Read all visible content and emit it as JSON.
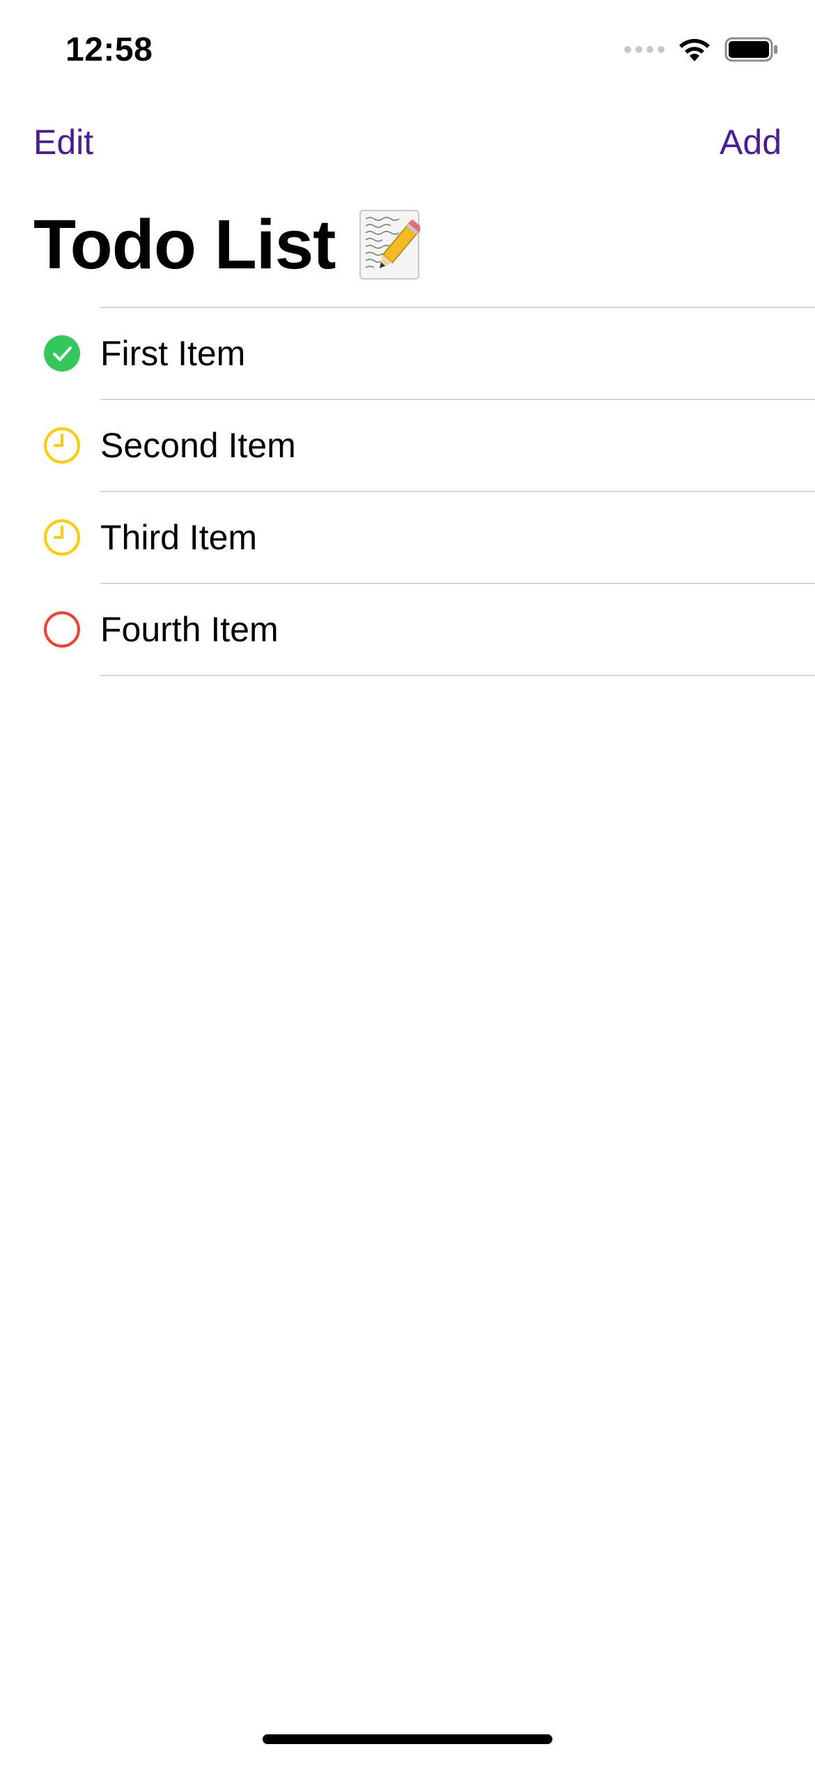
{
  "status_bar": {
    "time": "12:58",
    "icons": [
      "cellular-signal-icon",
      "wifi-icon",
      "battery-icon"
    ]
  },
  "nav": {
    "edit_label": "Edit",
    "add_label": "Add",
    "accent_color": "#4b1a99"
  },
  "title": {
    "text": "Todo List",
    "emoji_icon": "memo-icon"
  },
  "items": [
    {
      "label": "First Item",
      "status": "done",
      "icon": "checkmark-circle-icon",
      "color": "#34c759"
    },
    {
      "label": "Second Item",
      "status": "in-progress",
      "icon": "clock-icon",
      "color": "#ffcc00"
    },
    {
      "label": "Third Item",
      "status": "in-progress",
      "icon": "clock-icon",
      "color": "#ffcc00"
    },
    {
      "label": "Fourth Item",
      "status": "not-started",
      "icon": "empty-circle-icon",
      "color": "#ff3b30"
    }
  ]
}
